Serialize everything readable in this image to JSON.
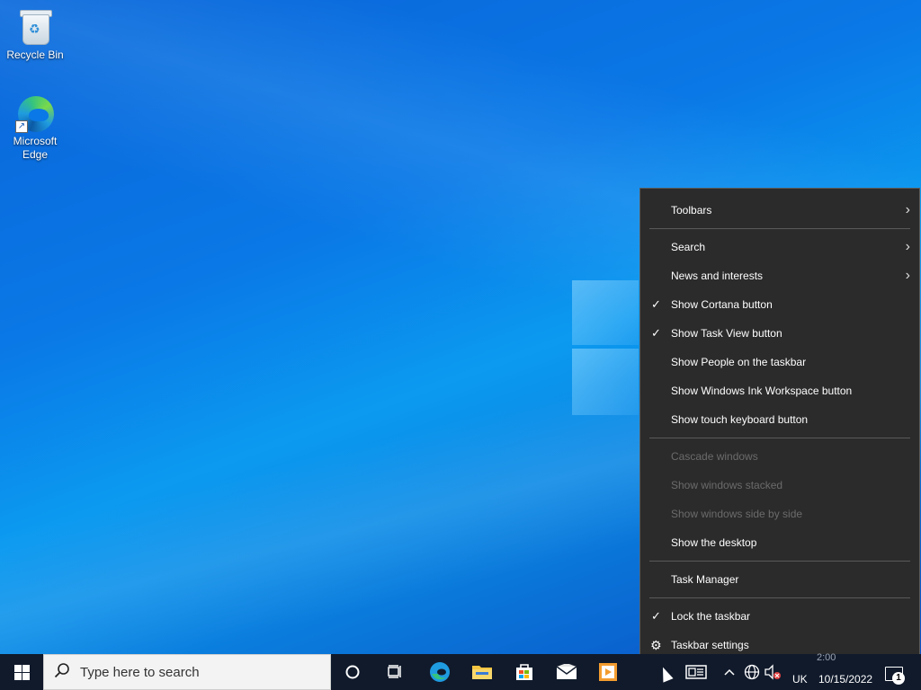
{
  "desktop": {
    "icons": [
      {
        "label": "Recycle Bin",
        "icon": "recycle-bin-icon"
      },
      {
        "label": "Microsoft Edge",
        "icon": "edge-icon"
      }
    ]
  },
  "context_menu": {
    "toolbars": "Toolbars",
    "search": "Search",
    "news": "News and interests",
    "cortana": "Show Cortana button",
    "taskview": "Show Task View button",
    "people": "Show People on the taskbar",
    "ink": "Show Windows Ink Workspace button",
    "keyboard": "Show touch keyboard button",
    "cascade": "Cascade windows",
    "stacked": "Show windows stacked",
    "sidebyside": "Show windows side by side",
    "desktop": "Show the desktop",
    "taskmgr": "Task Manager",
    "lock": "Lock the taskbar",
    "settings": "Taskbar settings",
    "check_glyph": "✓",
    "arrow_glyph": "›",
    "gear_glyph": "⚙"
  },
  "taskbar": {
    "search_placeholder": "Type here to search",
    "language": "UK",
    "date": "10/15/2022",
    "time_partial": "2:00",
    "notification_count": "1",
    "pinned": [
      "cortana-icon",
      "task-view-icon",
      "edge-icon",
      "file-explorer-icon",
      "store-icon",
      "mail-icon",
      "media-player-icon"
    ],
    "tray": [
      "news-icon",
      "chevron-up-icon",
      "network-icon",
      "volume-muted-icon"
    ]
  },
  "colors": {
    "taskbar": "#101a2b",
    "menu_bg": "#2b2b2b",
    "menu_disabled": "#6b6b6b",
    "wallpaper": "#0a78e6"
  }
}
